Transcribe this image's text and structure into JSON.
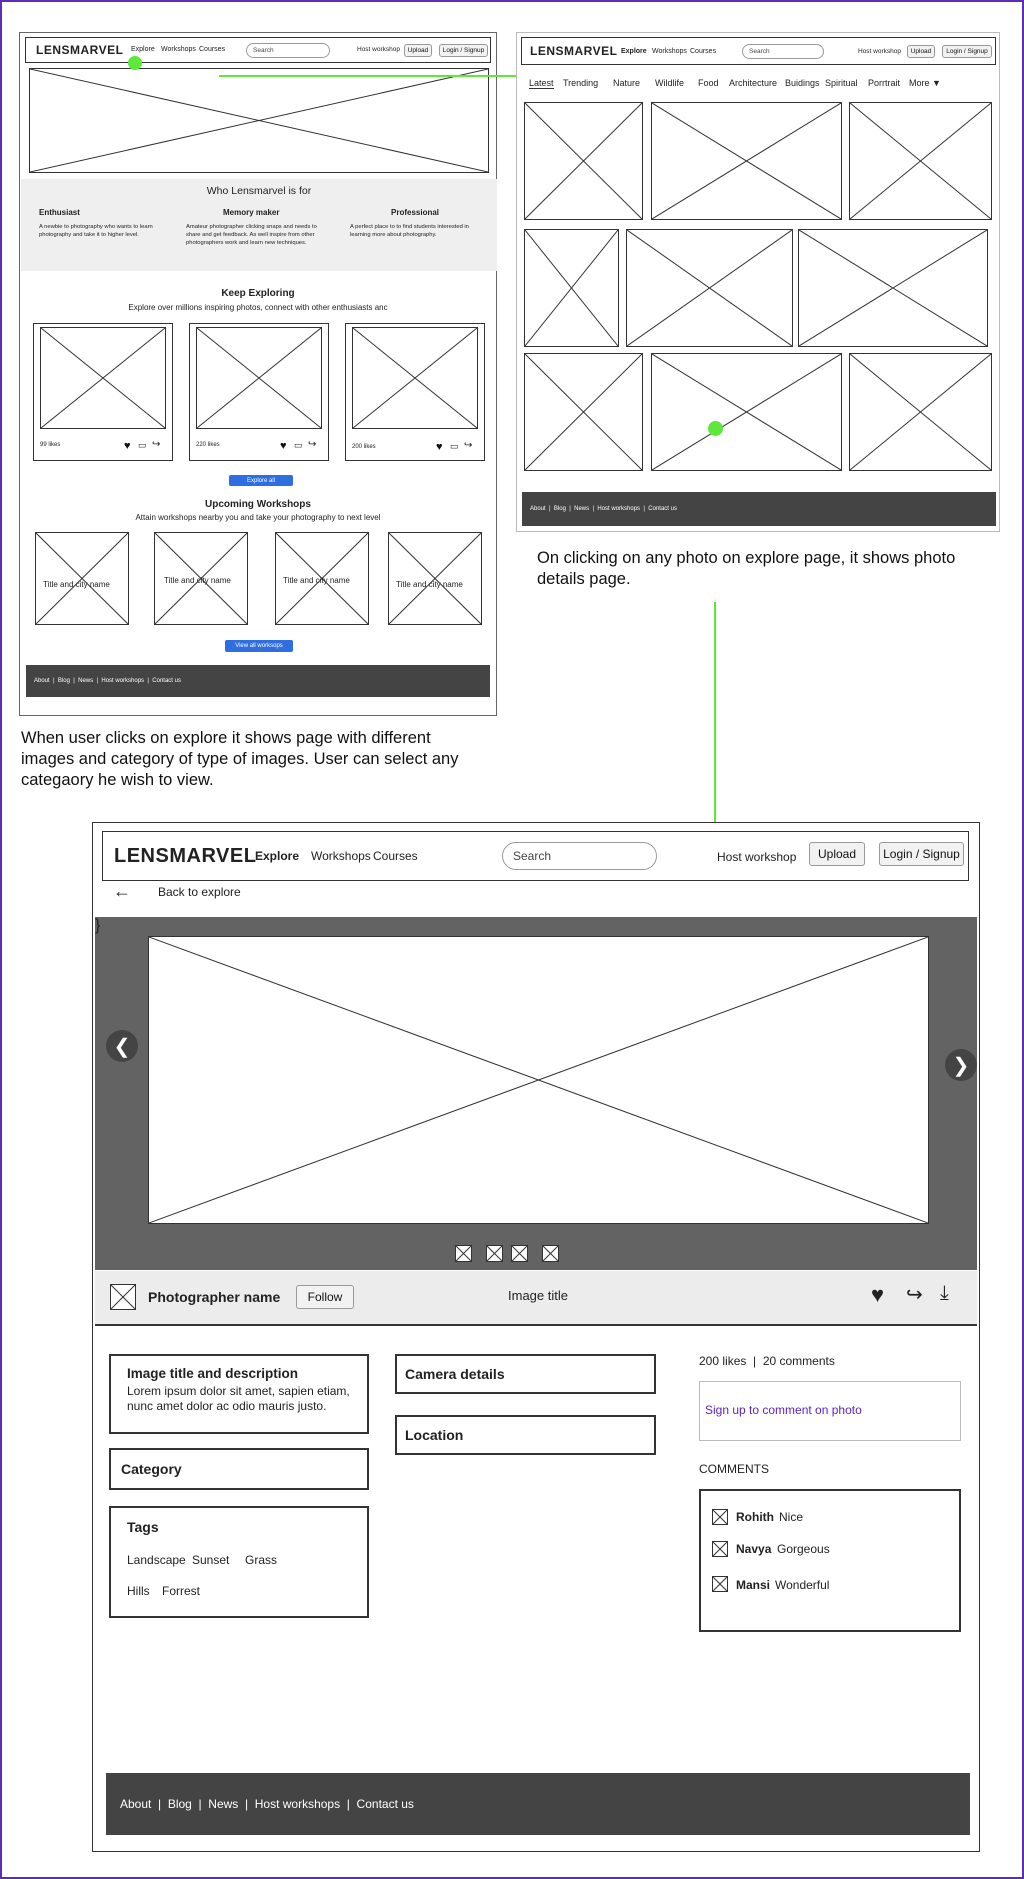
{
  "colors": {
    "frame": "#5b2db8",
    "arrow": "#5de83a",
    "footer": "#444444",
    "link": "#5b22c8",
    "button": "#2f6ee0",
    "hero": "#636363"
  },
  "wf1": {
    "logo": "LENSMARVEL",
    "nav": [
      "Explore",
      "Workshops",
      "Courses"
    ],
    "search": "Search",
    "host": "Host workshop",
    "upload": "Upload",
    "login": "Login / Signup",
    "who_title": "Who Lensmarvel is for",
    "personas": [
      {
        "title": "Enthusiast",
        "desc": "A newbie to photography who wants to learn photography and take it to higher level."
      },
      {
        "title": "Memory maker",
        "desc": "Amateur photographer clicking snaps and needs to share and get feedback. As well inspire from other photographers work and learn new techniques."
      },
      {
        "title": "Professional",
        "desc": "A perfect place to to find students interested in learning more about photography."
      }
    ],
    "keep_title": "Keep Exploring",
    "keep_sub": "Explore over millions inspiring photos, connect with other enthusiasts anc",
    "likes": [
      "99 likes",
      "220 likes",
      "200 likes"
    ],
    "explore_all": "Explore all",
    "upcoming_title": "Upcoming Workshops",
    "upcoming_sub": "Attain workshops nearby you and take your photography to next level",
    "workshop_label": "Title and city name",
    "view_all": "View all worksops",
    "footer": "About  |  Blog  |  News  |  Host workshops  |  Contact us"
  },
  "wf2": {
    "logo": "LENSMARVEL",
    "nav": [
      "Explore",
      "Workshops",
      "Courses"
    ],
    "search": "Search",
    "host": "Host workshop",
    "upload": "Upload",
    "login": "Login / Signup",
    "categories": [
      "Latest",
      "Trending",
      "Nature",
      "Wildlife",
      "Food",
      "Architecture",
      "Buidings",
      "Spiritual",
      "Porrtrait",
      "More ▼"
    ],
    "footer": "About  |  Blog  |  News  |  Host workshops  |  Contact us"
  },
  "notes": {
    "right": "On clicking on any photo on explore page, it shows photo details page.",
    "left": "When user clicks on explore it shows page with different images and category of type of images. User can select any categaory he wish to view."
  },
  "wf3": {
    "logo": "LENSMARVEL",
    "nav": [
      "Explore",
      "Workshops",
      "Courses"
    ],
    "search": "Search",
    "host": "Host workshop",
    "upload": "Upload",
    "login": "Login / Signup",
    "back": "Back to explore",
    "photographer": "Photographer name",
    "follow": "Follow",
    "image_title": "Image title",
    "desc_title": "Image title and description",
    "desc_text": "Lorem ipsum dolor sit amet, sapien etiam, nunc amet dolor ac odio mauris justo.",
    "category": "Category",
    "tags_title": "Tags",
    "tags_row1": [
      "Landscape",
      "Sunset",
      "Grass"
    ],
    "tags_row2": [
      "Hills",
      "Forrest"
    ],
    "camera": "Camera details",
    "location": "Location",
    "stats": "200 likes  |  20 comments",
    "signup_comment": "Sign up to comment on photo",
    "comments_title": "COMMENTS",
    "comments": [
      {
        "name": "Rohith",
        "text": "Nice"
      },
      {
        "name": "Navya",
        "text": "Gorgeous"
      },
      {
        "name": "Mansi",
        "text": "Wonderful"
      }
    ],
    "footer": "About  |  Blog  |  News  |  Host workshops  |  Contact us"
  }
}
